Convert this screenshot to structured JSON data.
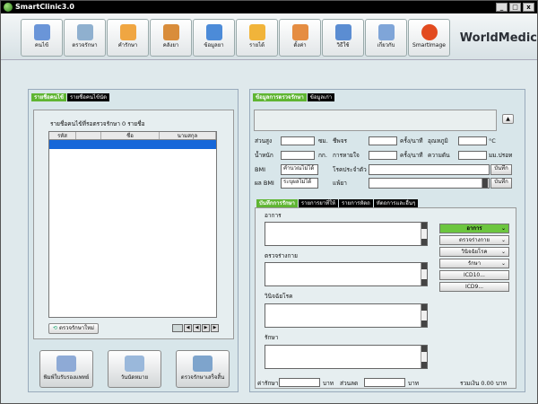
{
  "app": {
    "title": "SmartClinic3.0",
    "brand": "WorldMedic"
  },
  "window_buttons": [
    "_",
    "□",
    "x"
  ],
  "toolbar": [
    {
      "label": "คนไข้",
      "icon": "patient-card-icon",
      "color": "#6a95d8"
    },
    {
      "label": "ตรวจรักษา",
      "icon": "checkup-icon",
      "color": "#8fb0cf"
    },
    {
      "label": "คำรักษา",
      "icon": "fee-icon",
      "color": "#f0a642"
    },
    {
      "label": "คลังยา",
      "icon": "pharmacy-icon",
      "color": "#d98d3b"
    },
    {
      "label": "ข้อมูลยา",
      "icon": "drug-info-icon",
      "color": "#4c8bd8"
    },
    {
      "label": "รายได้",
      "icon": "income-icon",
      "color": "#f1b43a"
    },
    {
      "label": "ตั้งค่า",
      "icon": "settings-icon",
      "color": "#e58d42"
    },
    {
      "label": "วิธีใช้",
      "icon": "help-icon",
      "color": "#5b8dd2"
    },
    {
      "label": "เกี่ยวกับ",
      "icon": "about-icon",
      "color": "#7fa5d8"
    },
    {
      "label": "SmartImage",
      "icon": "smartimage-icon",
      "color": "#e24b20"
    }
  ],
  "left": {
    "tabs": [
      "รายชื่อคนไข้",
      "รายชื่อคนไข้นัด"
    ],
    "caption": "รายชื่อคนไข้ที่รอตรวจรักษา 0 รายชื่อ",
    "columns": [
      "รหัส",
      "",
      "ชื่อ",
      "นามสกุล"
    ],
    "new_button": "ตรวจรักษาใหม่",
    "nav": [
      "◀",
      "◀",
      "▶",
      "▶"
    ],
    "actions": [
      {
        "label": "พิมพ์ใบรับรองแพทย์",
        "icon": "printer-icon",
        "color": "#8eaad6"
      },
      {
        "label": "วันนัดหมาย",
        "icon": "calendar-icon",
        "color": "#9ab8db"
      },
      {
        "label": "ตรวจรักษาเสร็จสิ้น",
        "icon": "finish-checkup-icon",
        "color": "#7ea4cc"
      }
    ]
  },
  "right": {
    "tabs": [
      "ข้อมูลการตรวจรักษา",
      "ข้อมูลเก่า"
    ],
    "vitals": {
      "height": "ส่วนสูง",
      "cm": "ซม.",
      "pulse": "ชีพจร",
      "per_min": "ครั้ง/นาที",
      "temp": "อุณหภูมิ",
      "celsius": "°C",
      "weight": "น้ำหนัก",
      "kg": "กก.",
      "breath": "การหายใจ",
      "per_min2": "ครั้ง/นาที",
      "bp": "ความดัน",
      "mmhg": "มม.ปรอท",
      "bmi": "BMI",
      "bmi_val": "คำนวณไม่ได้",
      "disease": "โรคประจำตัว",
      "save1": "บันทึก",
      "bmi_result": "ผล BMI",
      "bmi_result_val": "ระบุผลไม่ได้",
      "allergy": "แพ้ยา",
      "save2": "บันทึก"
    },
    "subtabs": [
      "บันทึกการรักษา",
      "รายการยาที่ให้",
      "รายการหัตถ",
      "หัตถการและอื่นๆ"
    ],
    "sections": [
      "อาการ",
      "ตรวจร่างกาย",
      "วินิจฉัยโรค",
      "รักษา"
    ],
    "side_buttons": [
      "อาการ",
      "ตรวจร่างกาย",
      "วินิจฉัยโรค",
      "รักษา",
      "ICD10...",
      "ICD9..."
    ],
    "fee_label": "ค่ารักษา",
    "baht1": "บาท",
    "discount_label": "ส่วนลด",
    "baht2": "บาท",
    "total": "รวมเงิน 0.00 บาท"
  }
}
